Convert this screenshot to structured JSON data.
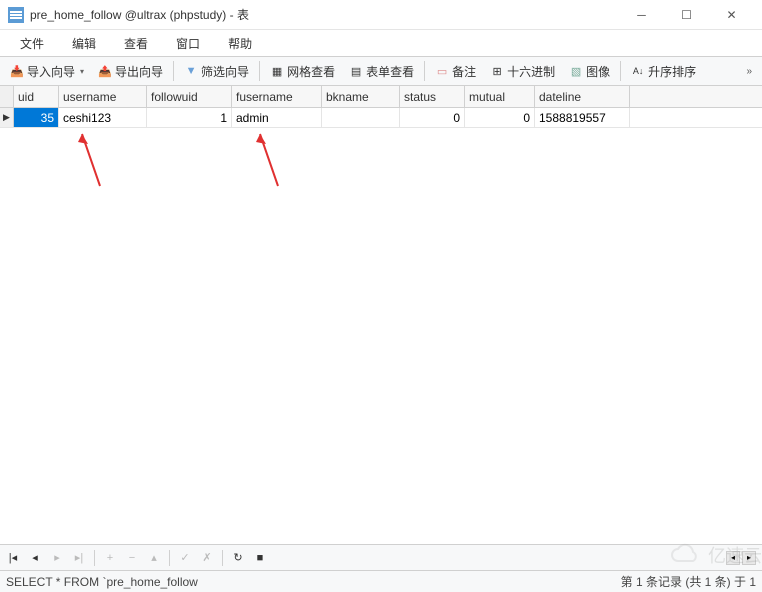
{
  "window": {
    "title": "pre_home_follow @ultrax (phpstudy) - 表"
  },
  "menu": {
    "file": "文件",
    "edit": "编辑",
    "view": "查看",
    "window": "窗口",
    "help": "帮助"
  },
  "toolbar": {
    "import": "导入向导",
    "export": "导出向导",
    "filter": "筛选向导",
    "gridview": "网格查看",
    "formview": "表单查看",
    "memo": "备注",
    "hex": "十六进制",
    "image": "图像",
    "sort": "升序排序"
  },
  "columns": {
    "uid": "uid",
    "username": "username",
    "followuid": "followuid",
    "fusername": "fusername",
    "bkname": "bkname",
    "status": "status",
    "mutual": "mutual",
    "dateline": "dateline"
  },
  "rows": [
    {
      "uid": "35",
      "username": "ceshi123",
      "followuid": "1",
      "fusername": "admin",
      "bkname": "",
      "status": "0",
      "mutual": "0",
      "dateline": "1588819557"
    }
  ],
  "status": {
    "sql": "SELECT * FROM `pre_home_follow",
    "record": "第 1 条记录 (共 1 条) 于 1"
  },
  "watermark": "亿速云"
}
